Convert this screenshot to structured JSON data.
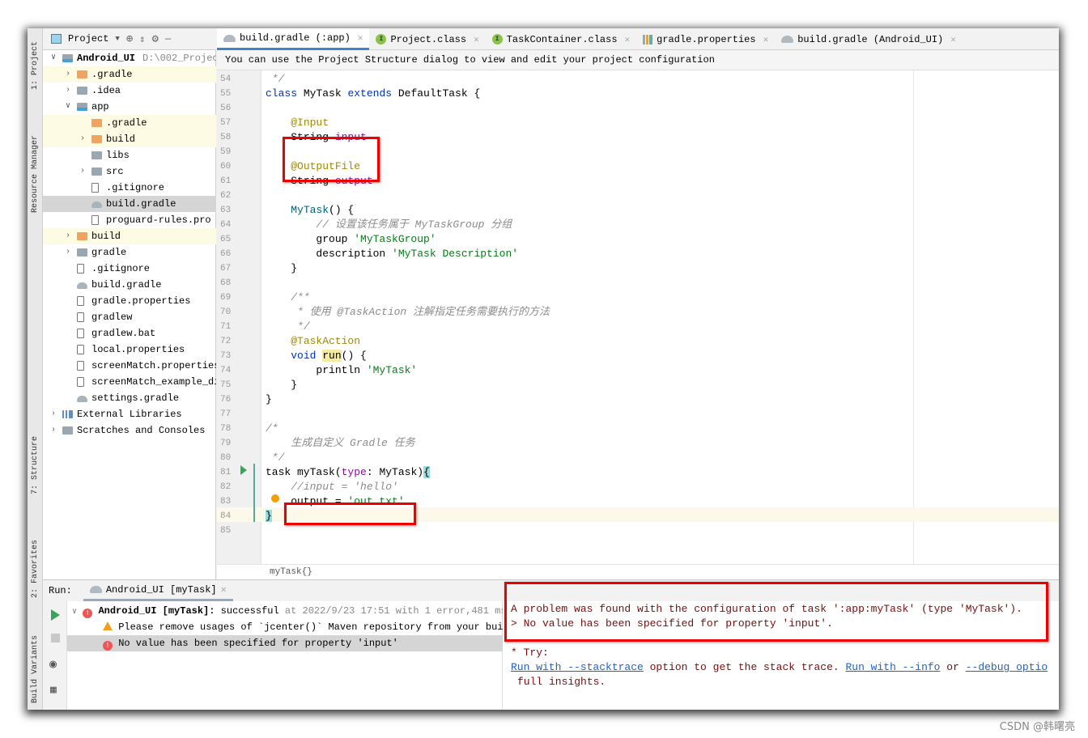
{
  "toolstrip": [
    "1: Project",
    "Resource Manager",
    "7: Structure",
    "2: Favorites",
    "Build Variants"
  ],
  "project_panel": {
    "title": "Project",
    "tree": [
      {
        "label": "Android_UI",
        "extra": "D:\\002_Projec",
        "depth": 0,
        "arrow": "down",
        "icon": "mod",
        "bold": true
      },
      {
        "label": ".gradle",
        "depth": 1,
        "arrow": "right",
        "icon": "orange",
        "excluded": true
      },
      {
        "label": ".idea",
        "depth": 1,
        "arrow": "right",
        "icon": "gray"
      },
      {
        "label": "app",
        "depth": 1,
        "arrow": "down",
        "icon": "mod"
      },
      {
        "label": ".gradle",
        "depth": 2,
        "icon": "orange",
        "excluded": true
      },
      {
        "label": "build",
        "depth": 2,
        "arrow": "right",
        "icon": "orange",
        "excluded": true
      },
      {
        "label": "libs",
        "depth": 2,
        "icon": "gray"
      },
      {
        "label": "src",
        "depth": 2,
        "arrow": "right",
        "icon": "gray"
      },
      {
        "label": ".gitignore",
        "depth": 2,
        "icon": "file"
      },
      {
        "label": "build.gradle",
        "depth": 2,
        "icon": "gradle",
        "selected": true
      },
      {
        "label": "proguard-rules.pro",
        "depth": 2,
        "icon": "file"
      },
      {
        "label": "build",
        "depth": 1,
        "arrow": "right",
        "icon": "orange",
        "excluded": true
      },
      {
        "label": "gradle",
        "depth": 1,
        "arrow": "right",
        "icon": "gray"
      },
      {
        "label": ".gitignore",
        "depth": 1,
        "icon": "file"
      },
      {
        "label": "build.gradle",
        "depth": 1,
        "icon": "gradle"
      },
      {
        "label": "gradle.properties",
        "depth": 1,
        "icon": "file"
      },
      {
        "label": "gradlew",
        "depth": 1,
        "icon": "file"
      },
      {
        "label": "gradlew.bat",
        "depth": 1,
        "icon": "file"
      },
      {
        "label": "local.properties",
        "depth": 1,
        "icon": "file"
      },
      {
        "label": "screenMatch.properties",
        "depth": 1,
        "icon": "file"
      },
      {
        "label": "screenMatch_example_di",
        "depth": 1,
        "icon": "file"
      },
      {
        "label": "settings.gradle",
        "depth": 1,
        "icon": "gradle"
      },
      {
        "label": "External Libraries",
        "depth": 0,
        "arrow": "right",
        "icon": "lib"
      },
      {
        "label": "Scratches and Consoles",
        "depth": 0,
        "arrow": "right",
        "icon": "gray"
      }
    ]
  },
  "tabs": [
    {
      "label": "build.gradle (:app)",
      "icon": "gradle",
      "active": true
    },
    {
      "label": "Project.class",
      "icon": "interface"
    },
    {
      "label": "TaskContainer.class",
      "icon": "interface"
    },
    {
      "label": "gradle.properties",
      "icon": "properties"
    },
    {
      "label": "build.gradle (Android_UI)",
      "icon": "gradle"
    }
  ],
  "notice": "You can use the Project Structure dialog to view and edit your project configuration",
  "editor": {
    "first_line": 54,
    "lines": [
      [
        [
          " */",
          "cm"
        ]
      ],
      [
        [
          "class",
          "kw"
        ],
        [
          " MyTask ",
          ""
        ],
        [
          "extends",
          "kw"
        ],
        [
          " DefaultTask {",
          ""
        ]
      ],
      [],
      [
        [
          "    ",
          ""
        ],
        [
          "@Input",
          "an"
        ]
      ],
      [
        [
          "    String ",
          ""
        ],
        [
          "input",
          "fd"
        ]
      ],
      [],
      [
        [
          "    ",
          ""
        ],
        [
          "@OutputFile",
          "an"
        ]
      ],
      [
        [
          "    String ",
          ""
        ],
        [
          "output",
          "fd"
        ]
      ],
      [],
      [
        [
          "    ",
          ""
        ],
        [
          "MyTask",
          "md"
        ],
        [
          "() {",
          ""
        ]
      ],
      [
        [
          "        ",
          ""
        ],
        [
          "// 设置该任务属于 MyTaskGroup 分组",
          "cm"
        ]
      ],
      [
        [
          "        group ",
          ""
        ],
        [
          "'MyTaskGroup'",
          "st"
        ]
      ],
      [
        [
          "        description ",
          ""
        ],
        [
          "'MyTask Description'",
          "st"
        ]
      ],
      [
        [
          "    }",
          ""
        ]
      ],
      [],
      [
        [
          "    ",
          ""
        ],
        [
          "/**",
          "cm"
        ]
      ],
      [
        [
          "     ",
          ""
        ],
        [
          "* 使用 @TaskAction 注解指定任务需要执行的方法",
          "cm"
        ]
      ],
      [
        [
          "     ",
          ""
        ],
        [
          "*/",
          "cm"
        ]
      ],
      [
        [
          "    ",
          ""
        ],
        [
          "@TaskAction",
          "an"
        ]
      ],
      [
        [
          "    ",
          ""
        ],
        [
          "void",
          "kw"
        ],
        [
          " ",
          ""
        ],
        [
          "run",
          "hl-run"
        ],
        [
          "() {",
          ""
        ]
      ],
      [
        [
          "        println ",
          ""
        ],
        [
          "'MyTask'",
          "st"
        ]
      ],
      [
        [
          "    }",
          ""
        ]
      ],
      [
        [
          "}",
          ""
        ]
      ],
      [],
      [
        [
          "/*",
          "cm"
        ]
      ],
      [
        [
          "    ",
          ""
        ],
        [
          "生成自定义 Gradle 任务",
          "cm"
        ]
      ],
      [
        [
          " */",
          "cm"
        ]
      ],
      [
        [
          "task myTask(",
          ""
        ],
        [
          "type",
          "fd"
        ],
        [
          ": MyTask)",
          ""
        ],
        [
          "{",
          "hl-br"
        ]
      ],
      [
        [
          "    ",
          ""
        ],
        [
          "//input = 'hello'",
          "cm"
        ]
      ],
      [
        [
          "    output = ",
          ""
        ],
        [
          "'out.txt'",
          "st"
        ]
      ],
      [
        [
          "}",
          "hl-br"
        ]
      ],
      []
    ],
    "breadcrumb": "myTask{}"
  },
  "run": {
    "label": "Run:",
    "tab": "Android_UI [myTask]",
    "tree": {
      "root_title": "Android_UI [myTask]:",
      "root_status": "successful",
      "root_detail": "at 2022/9/23 17:51 with 1 error,481 ms",
      "warning": "Please remove usages of `jcenter()` Maven repository from your build",
      "error": "No value has been specified for property 'input'"
    },
    "console": {
      "line1": "A problem was found with the configuration of task ':app:myTask' (type 'MyTask').",
      "line2": "> No value has been specified for property 'input'.",
      "try": "* Try:",
      "link1": "Run with --stacktrace",
      "text1": " option to get the stack trace. ",
      "link2": "Run with --info",
      "text2": " or ",
      "link3": "--debug optio",
      "line5": "full insights."
    }
  },
  "watermark": "CSDN @韩曙亮",
  "colors": {
    "highlight_box": "#e00000",
    "active_tab": "#4083c9",
    "console_text": "#7a0c0c",
    "link": "#2261c8"
  }
}
